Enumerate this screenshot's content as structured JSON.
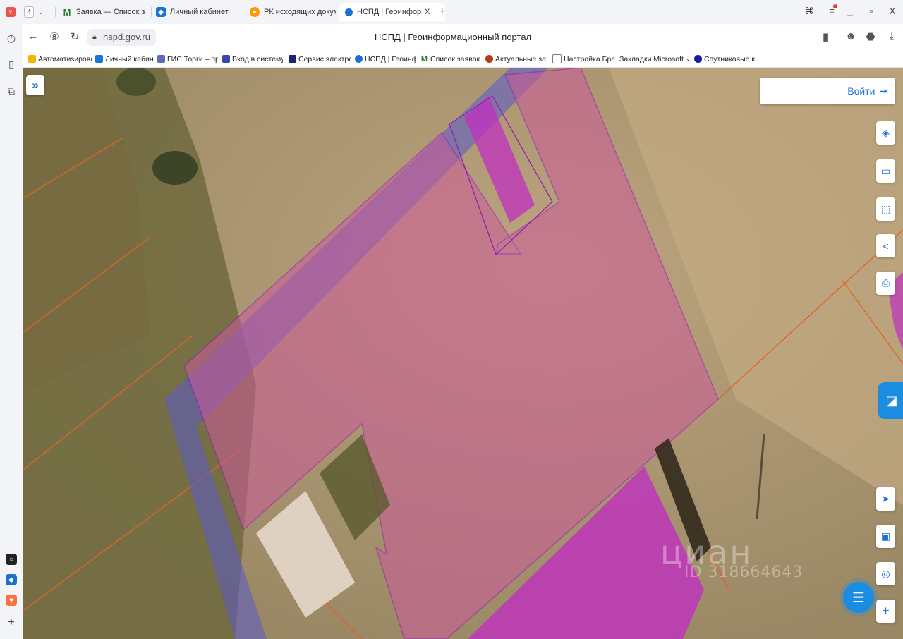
{
  "tabs": {
    "count_badge": "4",
    "items": [
      {
        "label": "Заявка — Список заявок",
        "icon": "gmail-icon",
        "color": "#2e7d32"
      },
      {
        "label": "Личный кабинет",
        "icon": "cabinet-icon",
        "color": "#1976d2"
      },
      {
        "label": "РК исходящих документов",
        "icon": "document-icon",
        "color": "#e65100"
      },
      {
        "label": "НСПД | Геоинформационный портал",
        "icon": "nspd-icon",
        "color": "#1d6fd1"
      }
    ],
    "close_label": "X",
    "new_tab": "+"
  },
  "window_controls": {
    "minimize": "_",
    "restore": "▫",
    "close": "X"
  },
  "address": {
    "url": "nspd.gov.ru",
    "page_title": "НСПД | Геоинформационный портал"
  },
  "bookmarks": [
    {
      "label": "Автоматизирован",
      "icon": "bookmark-auto-icon",
      "color": "#f4b400"
    },
    {
      "label": "Личный кабинет",
      "icon": "bookmark-cabinet-icon",
      "color": "#1976d2"
    },
    {
      "label": "ГИС Торги – прод",
      "icon": "bookmark-gis-icon",
      "color": "#5c6bc0"
    },
    {
      "label": "Вход в систему :: I",
      "icon": "bookmark-login-icon",
      "color": "#3949ab"
    },
    {
      "label": "Сервис электрон",
      "icon": "bookmark-service-icon",
      "color": "#1a237e"
    },
    {
      "label": "НСПД | Геоинфор",
      "icon": "bookmark-nspd-icon",
      "color": "#1d6fd1"
    },
    {
      "label": "Список заявок —",
      "icon": "bookmark-gmail-icon",
      "color": "#2e7d32"
    },
    {
      "label": "Актуальные заяв",
      "icon": "bookmark-actual-icon",
      "color": "#b23c17"
    },
    {
      "label": "Настройка Брауз",
      "icon": "bookmark-page-icon",
      "color": "#777777"
    },
    {
      "label": "Закладки Microsoft",
      "icon": "bookmark-folder-icon",
      "color": "#777777"
    },
    {
      "label": "Спутниковые кар",
      "icon": "bookmark-sat-icon",
      "color": "#1a1aa8"
    }
  ],
  "bookmarks_more": "»",
  "map": {
    "login_label": "Войти",
    "watermark": "циан",
    "watermark_id": "ID 318664643",
    "colors": {
      "parcel_fill": "#cc5a9a",
      "parcel_stroke": "#9a1ab8",
      "road_band": "#5a5ac8",
      "boundary_line": "#e0642a",
      "accent": "#1d6fd1"
    }
  },
  "tools": [
    {
      "name": "layers-icon",
      "glyph": "◈"
    },
    {
      "name": "ruler-icon",
      "glyph": "▭"
    },
    {
      "name": "select-area-icon",
      "glyph": "⬚"
    },
    {
      "name": "share-icon",
      "glyph": "<"
    },
    {
      "name": "print-icon",
      "glyph": "⎙"
    }
  ],
  "tools_bottom": [
    {
      "name": "locate-icon",
      "glyph": "➤"
    },
    {
      "name": "minimap-icon",
      "glyph": "▣"
    },
    {
      "name": "geo-search-icon",
      "glyph": "◎"
    },
    {
      "name": "zoom-in-icon",
      "glyph": "+"
    }
  ]
}
